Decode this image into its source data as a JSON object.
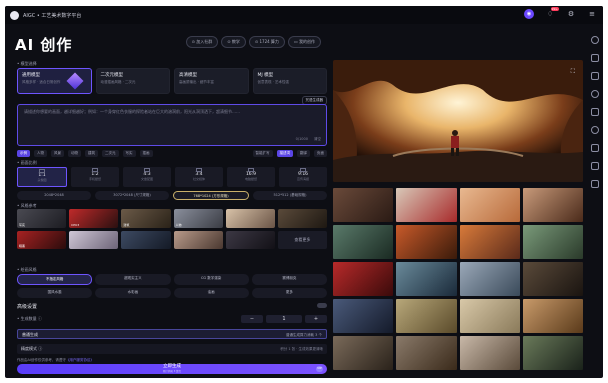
{
  "topbar": {
    "title": "AIGC • 工艺美术数字平台",
    "notif_count": "99+"
  },
  "page_title": "AI 创作",
  "top_actions": [
    "⊙ 加入社群",
    "⊙ 教学",
    "⊙ 1724 算力",
    "▭ 我的创作"
  ],
  "models": {
    "label": "• 模型选择",
    "items": [
      {
        "title": "通用模型",
        "sub": "风格多样 · 适合日常创作"
      },
      {
        "title": "二次元模型",
        "sub": "动漫插画风格 · 二次元"
      },
      {
        "title": "高清模型",
        "sub": "高画质输出 · 细节丰富"
      },
      {
        "title": "MJ 模型",
        "sub": "创意表现 · 艺术性强"
      }
    ]
  },
  "prompt": {
    "label": "• 画面描述",
    "tag_button": "咒语生成器",
    "placeholder": "请描述你想要的画面，越详细越好；例如：一个身穿红色衣服的探险者站在巨大的溶洞前，阳光从洞顶洒下，超清细节……",
    "counter": "0/1000",
    "clear": "清空"
  },
  "chips": {
    "items": [
      "示例",
      "人物",
      "风景",
      "动物",
      "建筑",
      "二次元",
      "写实",
      "插画"
    ],
    "right": [
      "智能扩写",
      "描述词",
      "翻译",
      "负面"
    ]
  },
  "ratio": {
    "label": "• 画面比例",
    "items": [
      {
        "value": "1:1",
        "sub": "头像图"
      },
      {
        "value": "1:2",
        "sub": "手机壁纸"
      },
      {
        "value": "4:3",
        "sub": "文章配图"
      },
      {
        "value": "3:4",
        "sub": "社交媒体"
      },
      {
        "value": "16:9",
        "sub": "电脑壁纸"
      },
      {
        "value": "9:16",
        "sub": "宣传海报"
      }
    ],
    "sizes": [
      "2048*2048",
      "3072*2048 (尺寸规格)",
      "768*1024 (方形规格)",
      "512*512 (基础规格)"
    ]
  },
  "ref": {
    "label": "• 风格参考",
    "items": [
      "写实",
      "CPU3",
      "建筑",
      "人物",
      "",
      "",
      "暗黑",
      "",
      "",
      "",
      "",
      "查看更多"
    ]
  },
  "style": {
    "label": "• 绘画风格",
    "items": [
      "不指定风格",
      "超现实主义",
      "CG 数字渲染",
      "赛博朋克",
      "国风水墨",
      "水彩画",
      "油画",
      "更多"
    ]
  },
  "advanced": {
    "title": "高级设置",
    "count_label": "• 生成数量 ⓘ",
    "minus": "−",
    "count": "1",
    "plus": "+",
    "mode": "普通生成",
    "mode_hint": "普通生成算力消耗 3 个",
    "quality": "精度模式 ⓘ",
    "quality_hint": "积分 1 张 · 生成效果更清晰",
    "notice": "作品由AI创作仅供参考，请遵守",
    "notice_link": "《用户服务协议》"
  },
  "generate": {
    "label": "立即生成",
    "sub": "预计消耗 3 算力",
    "badge": "VIP"
  },
  "colors": {
    "accent": "#6b48ff",
    "bg": "#0d0e14"
  }
}
